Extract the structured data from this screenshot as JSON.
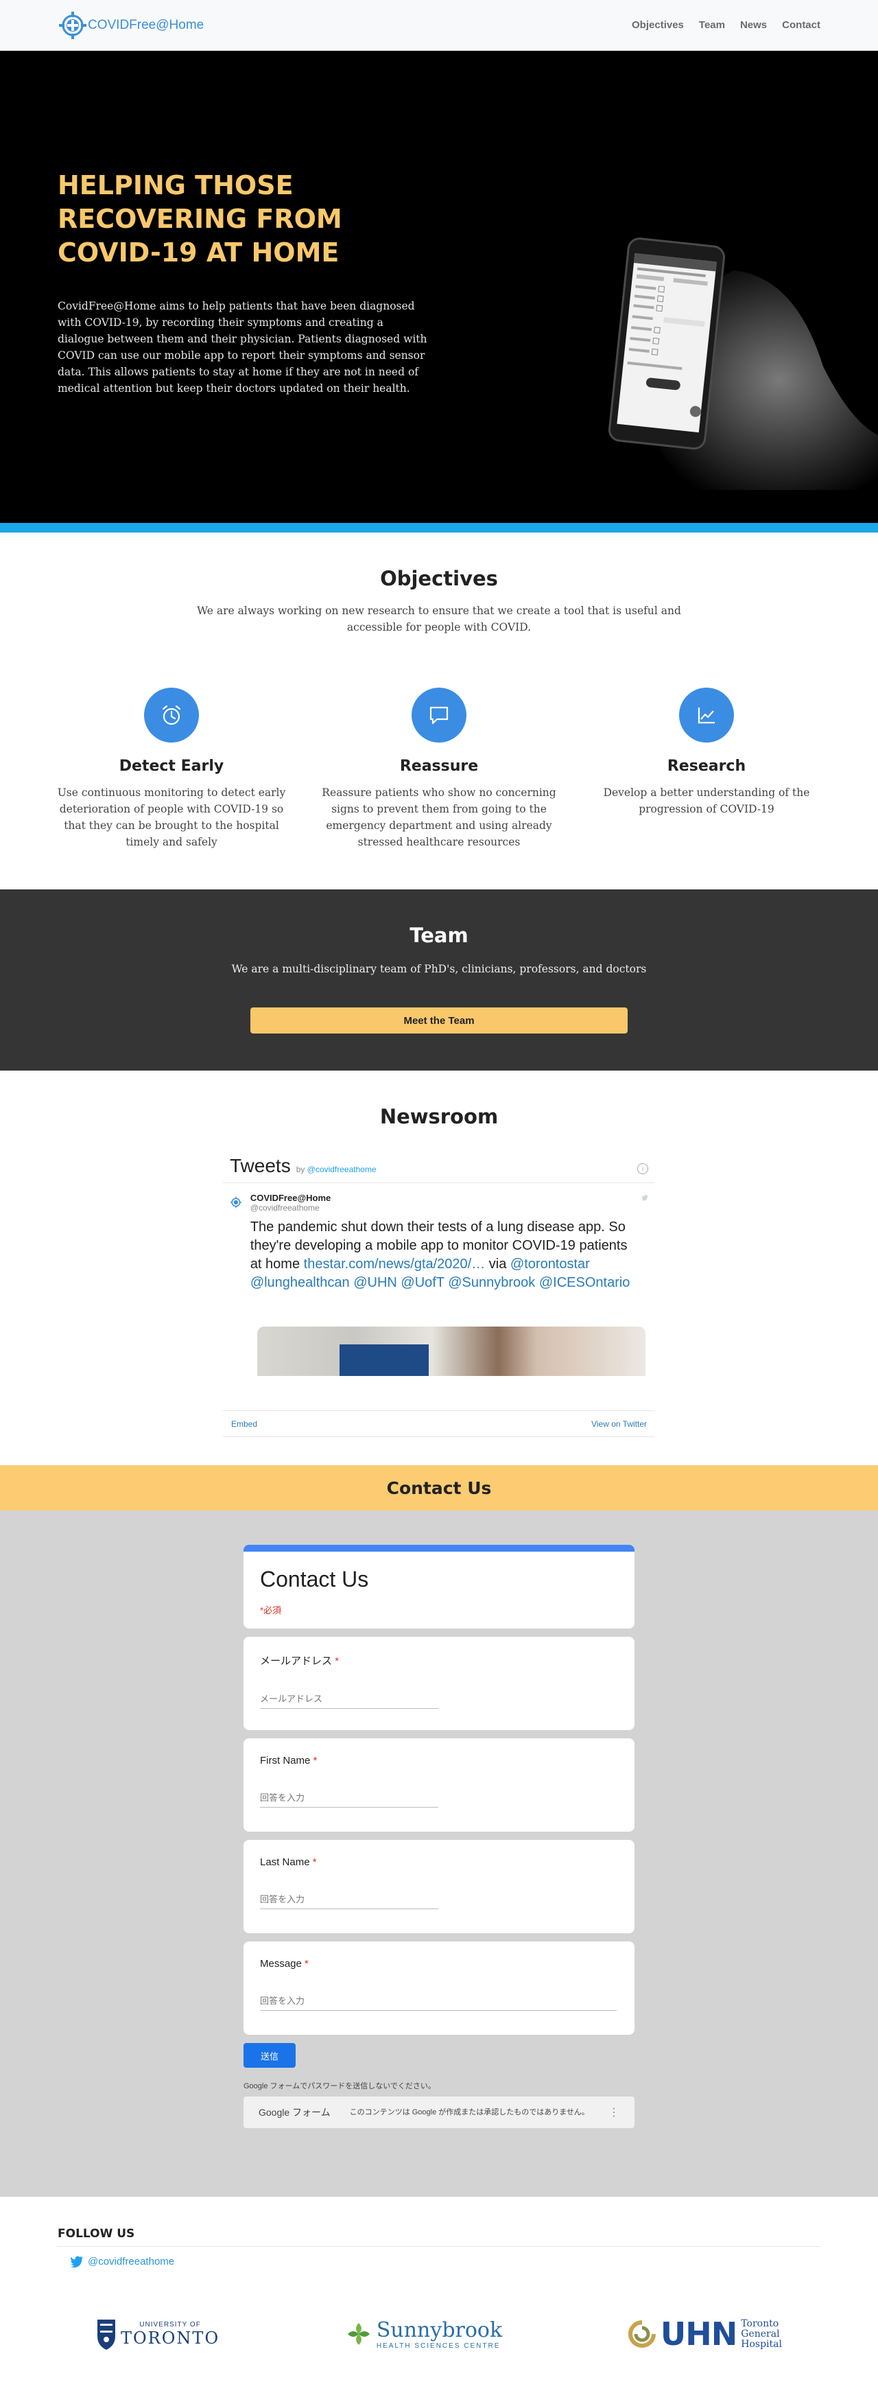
{
  "nav": {
    "brand": "COVIDFree@Home",
    "links": [
      "Objectives",
      "Team",
      "News",
      "Contact"
    ]
  },
  "hero": {
    "title": "HELPING THOSE RECOVERING FROM COVID-19 AT HOME",
    "text": "CovidFree@Home aims to help patients that have been diagnosed with COVID-19, by recording their symptoms and creating a dialogue between them and their physician. Patients diagnosed with COVID can use our mobile app to report their symptoms and sensor data. This allows patients to stay at home if they are not in need of medical attention but keep their doctors updated on their health."
  },
  "objectives": {
    "title": "Objectives",
    "subtitle": "We are always working on new research to ensure that we create a tool that is useful and accessible for people with COVID.",
    "items": [
      {
        "icon": "alarm-clock-icon",
        "title": "Detect Early",
        "text": "Use continuous monitoring to detect early deterioration of people with COVID-19 so that they can be brought to the hospital timely and safely"
      },
      {
        "icon": "chat-bubble-icon",
        "title": "Reassure",
        "text": "Reassure patients who show no concerning signs to prevent them from going to the emergency department and using already stressed healthcare resources"
      },
      {
        "icon": "chart-line-icon",
        "title": "Research",
        "text": "Develop a better understanding of the progression of COVID-19"
      }
    ]
  },
  "team": {
    "title": "Team",
    "subtitle": "We are a multi-disciplinary team of PhD's, clinicians, professors, and doctors",
    "button": "Meet the Team"
  },
  "news": {
    "title": "Newsroom",
    "widget_title": "Tweets",
    "widget_by": "by",
    "widget_handle": "@covidfreeathome",
    "tweet": {
      "name": "COVIDFree@Home",
      "handle": "@covidfreeathome",
      "text_plain": "The pandemic shut down their tests of a lung disease app. So they're developing a mobile app to monitor COVID-19 patients at home ",
      "link": "thestar.com/news/gta/2020/…",
      "via": " via ",
      "mentions": "@torontostar @lunghealthcan @UHN @UofT @Sunnybrook @ICESOntario"
    },
    "embed": "Embed",
    "view_on_twitter": "View on Twitter"
  },
  "contact": {
    "title": "Contact Us",
    "form_title": "Contact Us",
    "required_note": "*必須",
    "fields": [
      {
        "label": "メールアドレス",
        "placeholder": "メールアドレス"
      },
      {
        "label": "First Name",
        "placeholder": "回答を入力"
      },
      {
        "label": "Last Name",
        "placeholder": "回答を入力"
      },
      {
        "label": "Message",
        "placeholder": "回答を入力"
      }
    ],
    "submit": "送信",
    "password_note": "Google フォームでパスワードを送信しないでください。",
    "footer_brand": "Google フォーム",
    "footer_msg": "このコンテンツは Google が作成または承認したものではありません。"
  },
  "footer": {
    "follow": "FOLLOW US",
    "twitter": "@covidfreeathome",
    "logos": {
      "uoft_small": "UNIVERSITY OF",
      "uoft_big": "TORONTO",
      "sunnybrook": "Sunnybrook",
      "sunnybrook_sub": "HEALTH SCIENCES CENTRE",
      "uhn": "UHN",
      "uhn_sub1": "Toronto",
      "uhn_sub2": "General",
      "uhn_sub3": "Hospital"
    }
  }
}
